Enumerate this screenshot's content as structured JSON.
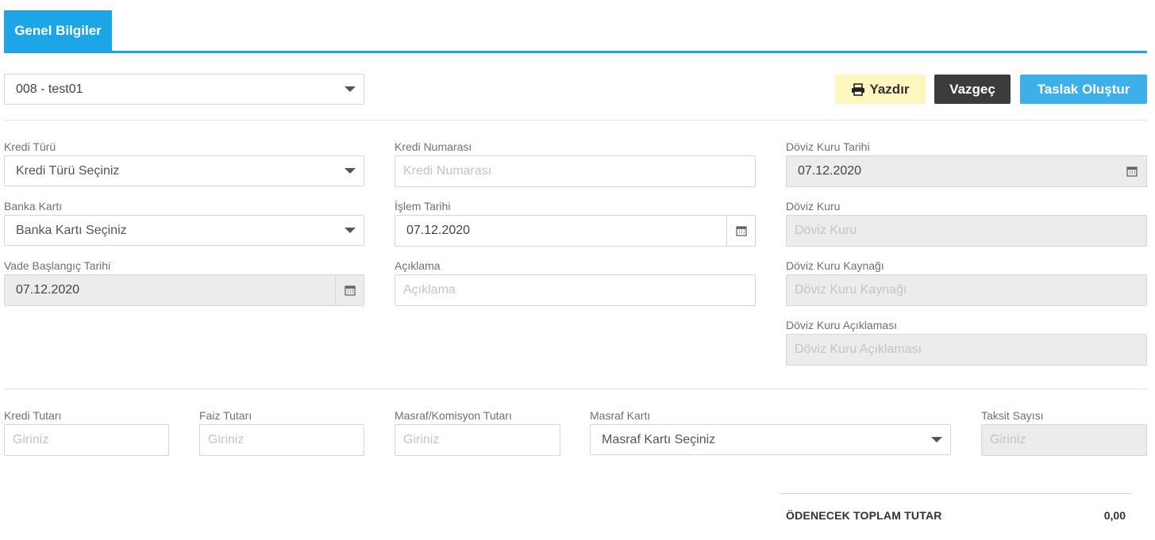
{
  "tabs": [
    {
      "label": "Genel Bilgiler"
    }
  ],
  "top_select": {
    "value": "008 - test01"
  },
  "toolbar": {
    "print_label": "Yazdır",
    "cancel_label": "Vazgeç",
    "create_label": "Taslak Oluştur"
  },
  "form": {
    "kredi_turu": {
      "label": "Kredi Türü",
      "placeholder": "Kredi Türü Seçiniz"
    },
    "banka_karti": {
      "label": "Banka Kartı",
      "placeholder": "Banka Kartı Seçiniz"
    },
    "vade_baslangic": {
      "label": "Vade Başlangıç Tarihi",
      "value": "07.12.2020"
    },
    "kredi_numarasi": {
      "label": "Kredi Numarası",
      "placeholder": "Kredi Numarası"
    },
    "islem_tarihi": {
      "label": "İşlem Tarihi",
      "value": "07.12.2020"
    },
    "aciklama": {
      "label": "Açıklama",
      "placeholder": "Açıklama"
    },
    "doviz_kuru_tarihi": {
      "label": "Döviz Kuru Tarihi",
      "value": "07.12.2020"
    },
    "doviz_kuru": {
      "label": "Döviz Kuru",
      "placeholder": "Döviz Kuru"
    },
    "doviz_kuru_kaynagi": {
      "label": "Döviz Kuru Kaynağı",
      "placeholder": "Döviz Kuru Kaynağı"
    },
    "doviz_kuru_aciklamasi": {
      "label": "Döviz Kuru Açıklaması",
      "placeholder": "Döviz Kuru Açıklaması"
    }
  },
  "amounts": {
    "kredi_tutari": {
      "label": "Kredi Tutarı",
      "placeholder": "Giriniz"
    },
    "faiz_tutari": {
      "label": "Faiz Tutarı",
      "placeholder": "Giriniz"
    },
    "masraf_komisyon": {
      "label": "Masraf/Komisyon Tutarı",
      "placeholder": "Giriniz"
    },
    "masraf_karti": {
      "label": "Masraf Kartı",
      "placeholder": "Masraf Kartı Seçiniz"
    },
    "taksit_sayisi": {
      "label": "Taksit Sayısı",
      "placeholder": "Giriniz"
    }
  },
  "total": {
    "label": "ÖDENECEK TOPLAM TUTAR",
    "value": "0,00"
  },
  "icons": {
    "print": "printer-icon",
    "calendar": "calendar-icon",
    "dropdown": "caret-down-icon"
  },
  "colors": {
    "accent": "#1ca6e8",
    "print_bg": "#fdf6bf",
    "cancel_bg": "#3c3c3c",
    "create_bg": "#3dafe9",
    "disabled_bg": "#ececec"
  }
}
